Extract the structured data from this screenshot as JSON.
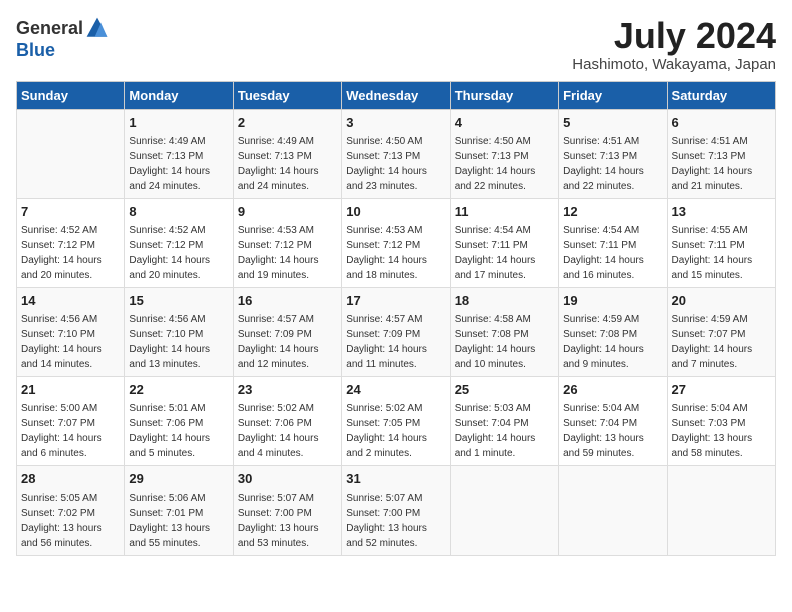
{
  "header": {
    "logo_general": "General",
    "logo_blue": "Blue",
    "title": "July 2024",
    "location": "Hashimoto, Wakayama, Japan"
  },
  "weekdays": [
    "Sunday",
    "Monday",
    "Tuesday",
    "Wednesday",
    "Thursday",
    "Friday",
    "Saturday"
  ],
  "weeks": [
    [
      {
        "day": "",
        "info": ""
      },
      {
        "day": "1",
        "info": "Sunrise: 4:49 AM\nSunset: 7:13 PM\nDaylight: 14 hours\nand 24 minutes."
      },
      {
        "day": "2",
        "info": "Sunrise: 4:49 AM\nSunset: 7:13 PM\nDaylight: 14 hours\nand 24 minutes."
      },
      {
        "day": "3",
        "info": "Sunrise: 4:50 AM\nSunset: 7:13 PM\nDaylight: 14 hours\nand 23 minutes."
      },
      {
        "day": "4",
        "info": "Sunrise: 4:50 AM\nSunset: 7:13 PM\nDaylight: 14 hours\nand 22 minutes."
      },
      {
        "day": "5",
        "info": "Sunrise: 4:51 AM\nSunset: 7:13 PM\nDaylight: 14 hours\nand 22 minutes."
      },
      {
        "day": "6",
        "info": "Sunrise: 4:51 AM\nSunset: 7:13 PM\nDaylight: 14 hours\nand 21 minutes."
      }
    ],
    [
      {
        "day": "7",
        "info": "Sunrise: 4:52 AM\nSunset: 7:12 PM\nDaylight: 14 hours\nand 20 minutes."
      },
      {
        "day": "8",
        "info": "Sunrise: 4:52 AM\nSunset: 7:12 PM\nDaylight: 14 hours\nand 20 minutes."
      },
      {
        "day": "9",
        "info": "Sunrise: 4:53 AM\nSunset: 7:12 PM\nDaylight: 14 hours\nand 19 minutes."
      },
      {
        "day": "10",
        "info": "Sunrise: 4:53 AM\nSunset: 7:12 PM\nDaylight: 14 hours\nand 18 minutes."
      },
      {
        "day": "11",
        "info": "Sunrise: 4:54 AM\nSunset: 7:11 PM\nDaylight: 14 hours\nand 17 minutes."
      },
      {
        "day": "12",
        "info": "Sunrise: 4:54 AM\nSunset: 7:11 PM\nDaylight: 14 hours\nand 16 minutes."
      },
      {
        "day": "13",
        "info": "Sunrise: 4:55 AM\nSunset: 7:11 PM\nDaylight: 14 hours\nand 15 minutes."
      }
    ],
    [
      {
        "day": "14",
        "info": "Sunrise: 4:56 AM\nSunset: 7:10 PM\nDaylight: 14 hours\nand 14 minutes."
      },
      {
        "day": "15",
        "info": "Sunrise: 4:56 AM\nSunset: 7:10 PM\nDaylight: 14 hours\nand 13 minutes."
      },
      {
        "day": "16",
        "info": "Sunrise: 4:57 AM\nSunset: 7:09 PM\nDaylight: 14 hours\nand 12 minutes."
      },
      {
        "day": "17",
        "info": "Sunrise: 4:57 AM\nSunset: 7:09 PM\nDaylight: 14 hours\nand 11 minutes."
      },
      {
        "day": "18",
        "info": "Sunrise: 4:58 AM\nSunset: 7:08 PM\nDaylight: 14 hours\nand 10 minutes."
      },
      {
        "day": "19",
        "info": "Sunrise: 4:59 AM\nSunset: 7:08 PM\nDaylight: 14 hours\nand 9 minutes."
      },
      {
        "day": "20",
        "info": "Sunrise: 4:59 AM\nSunset: 7:07 PM\nDaylight: 14 hours\nand 7 minutes."
      }
    ],
    [
      {
        "day": "21",
        "info": "Sunrise: 5:00 AM\nSunset: 7:07 PM\nDaylight: 14 hours\nand 6 minutes."
      },
      {
        "day": "22",
        "info": "Sunrise: 5:01 AM\nSunset: 7:06 PM\nDaylight: 14 hours\nand 5 minutes."
      },
      {
        "day": "23",
        "info": "Sunrise: 5:02 AM\nSunset: 7:06 PM\nDaylight: 14 hours\nand 4 minutes."
      },
      {
        "day": "24",
        "info": "Sunrise: 5:02 AM\nSunset: 7:05 PM\nDaylight: 14 hours\nand 2 minutes."
      },
      {
        "day": "25",
        "info": "Sunrise: 5:03 AM\nSunset: 7:04 PM\nDaylight: 14 hours\nand 1 minute."
      },
      {
        "day": "26",
        "info": "Sunrise: 5:04 AM\nSunset: 7:04 PM\nDaylight: 13 hours\nand 59 minutes."
      },
      {
        "day": "27",
        "info": "Sunrise: 5:04 AM\nSunset: 7:03 PM\nDaylight: 13 hours\nand 58 minutes."
      }
    ],
    [
      {
        "day": "28",
        "info": "Sunrise: 5:05 AM\nSunset: 7:02 PM\nDaylight: 13 hours\nand 56 minutes."
      },
      {
        "day": "29",
        "info": "Sunrise: 5:06 AM\nSunset: 7:01 PM\nDaylight: 13 hours\nand 55 minutes."
      },
      {
        "day": "30",
        "info": "Sunrise: 5:07 AM\nSunset: 7:00 PM\nDaylight: 13 hours\nand 53 minutes."
      },
      {
        "day": "31",
        "info": "Sunrise: 5:07 AM\nSunset: 7:00 PM\nDaylight: 13 hours\nand 52 minutes."
      },
      {
        "day": "",
        "info": ""
      },
      {
        "day": "",
        "info": ""
      },
      {
        "day": "",
        "info": ""
      }
    ]
  ]
}
